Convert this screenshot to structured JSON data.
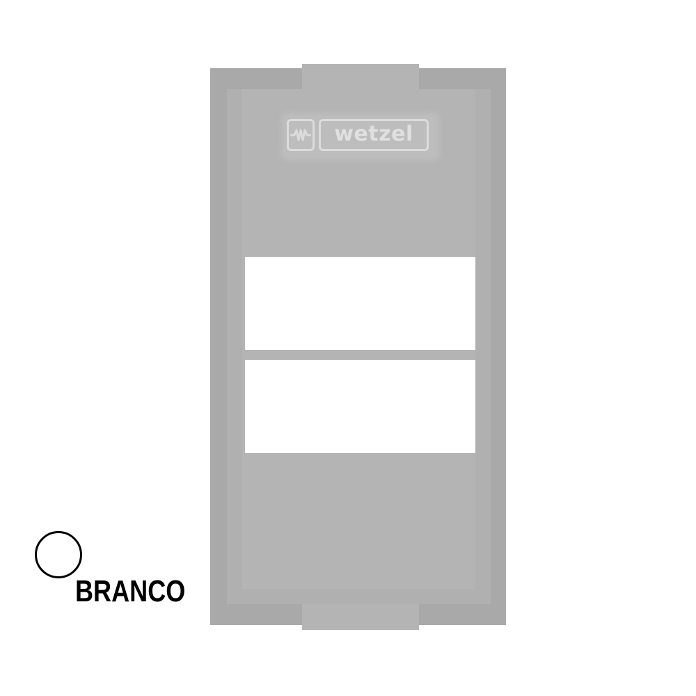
{
  "product": {
    "brand_logo_text": "wetzel",
    "brand_logo_icon": "wetzel-wave-logo-icon"
  },
  "color_option": {
    "label": "BRANCO",
    "swatch_color": "#ffffff"
  },
  "colors": {
    "module_frame": "#a9a9a9",
    "module_face": "#b4b4b4",
    "logo": "#dcdcdc",
    "openings": "#ffffff",
    "label_text": "#000000"
  }
}
